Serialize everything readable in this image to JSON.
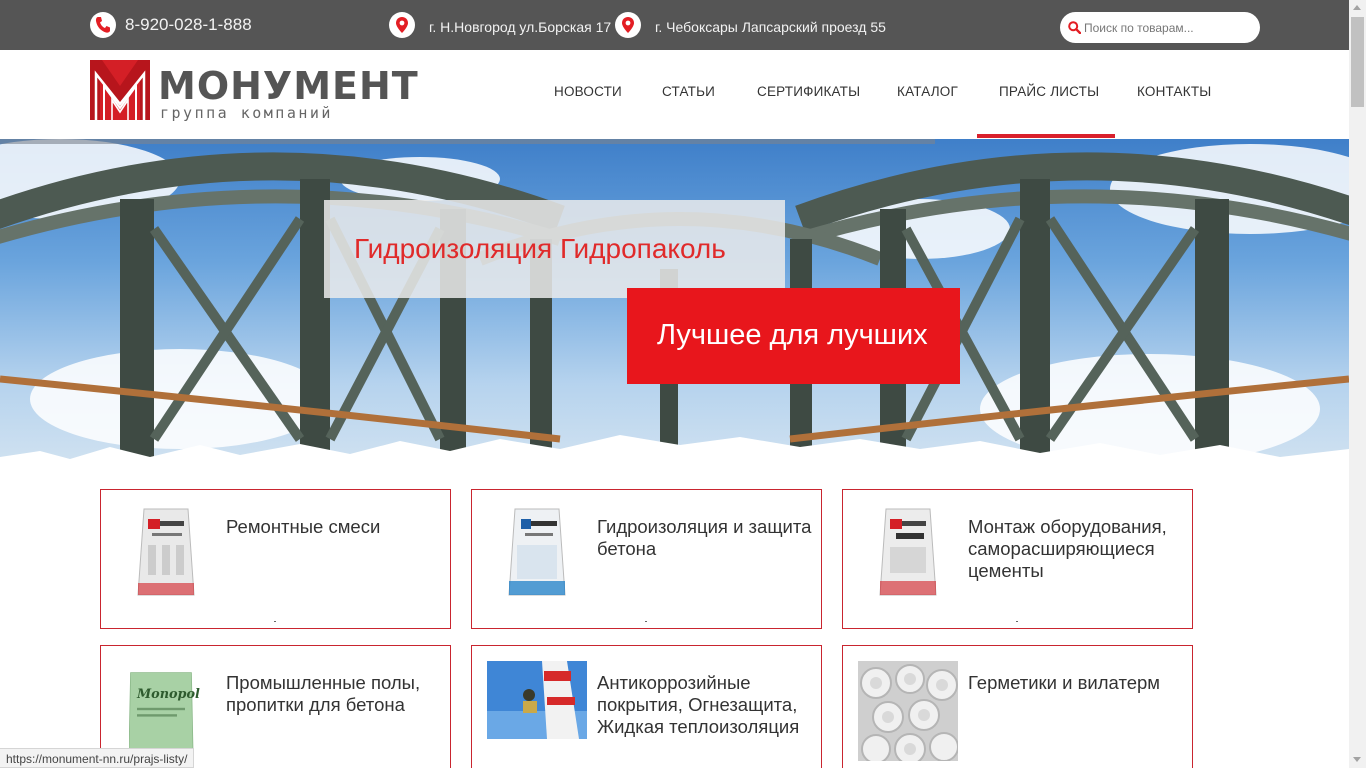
{
  "topbar": {
    "phone": "8-920-028-1-888",
    "address1": "г. Н.Новгород ул.Борская 17",
    "address2": "г. Чебоксары Лапсарский проезд 55",
    "search_placeholder": "Поиск по товарам...",
    "icons": {
      "phone": "phone-icon",
      "address": "map-pin-icon",
      "search": "search-icon"
    }
  },
  "logo": {
    "word": "МОНУМЕНТ",
    "sub": "группа компаний"
  },
  "nav": {
    "items": [
      "НОВОСТИ",
      "СТАТЬИ",
      "СЕРТИФИКАТЫ",
      "КАТАЛОГ",
      "ПРАЙС ЛИСТЫ",
      "КОНТАКТЫ"
    ],
    "active_index": 4
  },
  "hero": {
    "title": "Гидроизоляция Гидропаколь",
    "subtitle": "Лучшее для лучших"
  },
  "products": [
    {
      "title": "Ремонтные смеси",
      "thumb": "bag-pakol-remontny"
    },
    {
      "title": "Гидроизоляция и защита бетона",
      "thumb": "bag-gidropakol"
    },
    {
      "title": "Монтаж оборудования, саморасширяющиеся цементы",
      "thumb": "bag-pakol-litievoy"
    },
    {
      "title": "Промышленные полы, пропитки для бетона",
      "thumb": "bag-monopol"
    },
    {
      "title": "Антикоррозийные покрытия, Огнезащита, Жидкая теплоизоляция",
      "thumb": "photo-chimney-worker"
    },
    {
      "title": "Герметики и вилатерм",
      "thumb": "photo-vilaterm-rolls"
    }
  ],
  "status_url": "https://monument-nn.ru/prajs-listy/",
  "colors": {
    "accent": "#d9202c",
    "topbar": "#555555",
    "hero_red": "#e8161c"
  }
}
